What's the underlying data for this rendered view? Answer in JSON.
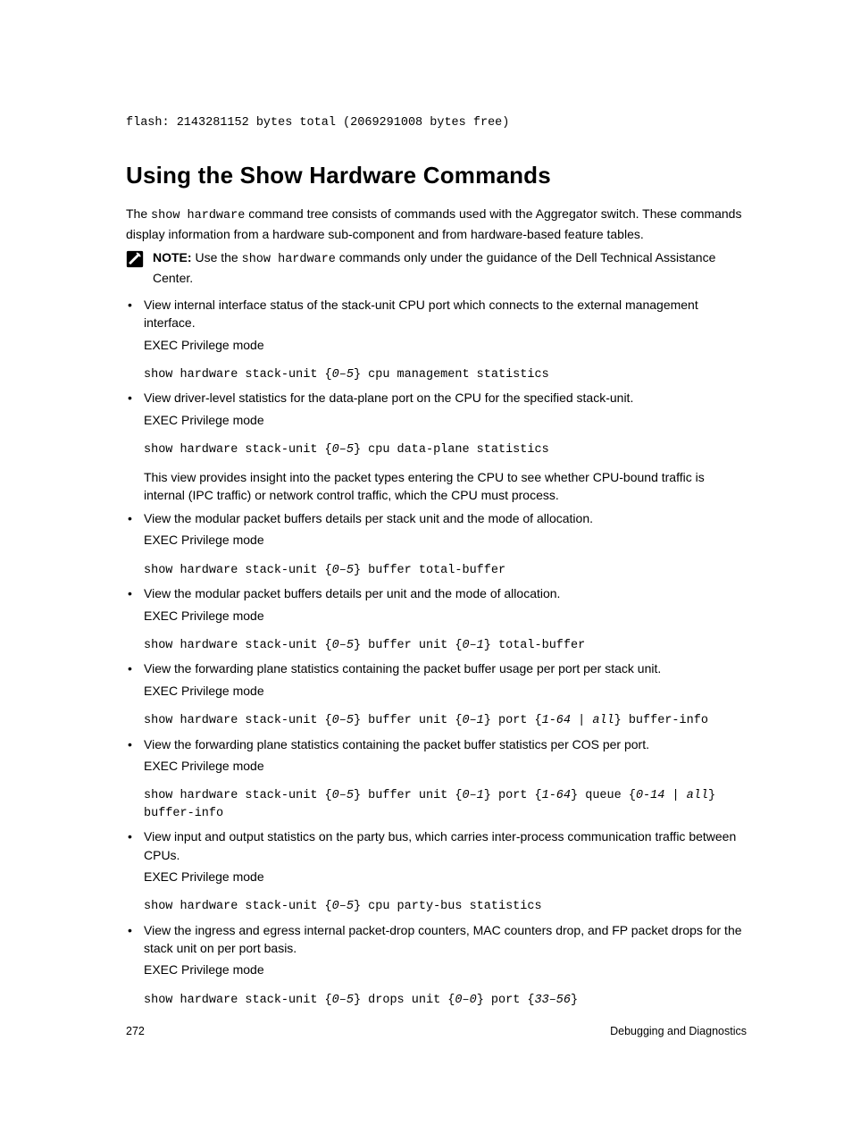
{
  "preformatted_top": "flash: 2143281152 bytes total (2069291008 bytes free)",
  "heading": "Using the Show Hardware Commands",
  "intro": {
    "pre": "The ",
    "code": "show hardware",
    "post": " command tree consists of commands used with the Aggregator switch. These commands display information from a hardware sub-component and from hardware-based feature tables."
  },
  "note": {
    "label": "NOTE:",
    "pre": " Use the ",
    "code": "show hardware",
    "post": " commands only under the guidance of the Dell Technical Assistance Center."
  },
  "items": [
    {
      "desc": "View internal interface status of the stack-unit CPU port which connects to the external management interface.",
      "mode": "EXEC Privilege mode",
      "cmd_parts": [
        {
          "t": "show hardware stack-unit {",
          "i": false
        },
        {
          "t": "0–5",
          "i": true
        },
        {
          "t": "} cpu management statistics",
          "i": false
        }
      ]
    },
    {
      "desc": "View driver-level statistics for the data-plane port on the CPU for the specified stack-unit.",
      "mode": "EXEC Privilege mode",
      "cmd_parts": [
        {
          "t": "show hardware stack-unit {",
          "i": false
        },
        {
          "t": "0–5",
          "i": true
        },
        {
          "t": "} cpu data-plane statistics",
          "i": false
        }
      ],
      "post": "This view provides insight into the packet types entering the CPU to see whether CPU-bound traffic is internal (IPC traffic) or network control traffic, which the CPU must process."
    },
    {
      "desc": "View the modular packet buffers details per stack unit and the mode of allocation.",
      "mode": "EXEC Privilege mode",
      "cmd_parts": [
        {
          "t": "show hardware stack-unit {",
          "i": false
        },
        {
          "t": "0–5",
          "i": true
        },
        {
          "t": "} buffer total-buffer",
          "i": false
        }
      ]
    },
    {
      "desc": "View the modular packet buffers details per unit and the mode of allocation.",
      "mode": "EXEC Privilege mode",
      "cmd_parts": [
        {
          "t": "show hardware stack-unit {",
          "i": false
        },
        {
          "t": "0–5",
          "i": true
        },
        {
          "t": "} buffer unit {",
          "i": false
        },
        {
          "t": "0–1",
          "i": true
        },
        {
          "t": "} total-buffer",
          "i": false
        }
      ]
    },
    {
      "desc": "View the forwarding plane statistics containing the packet buffer usage per port per stack unit.",
      "mode": "EXEC Privilege mode",
      "cmd_parts": [
        {
          "t": "show hardware stack-unit {",
          "i": false
        },
        {
          "t": "0–5",
          "i": true
        },
        {
          "t": "} buffer unit {",
          "i": false
        },
        {
          "t": "0–1",
          "i": true
        },
        {
          "t": "} port {",
          "i": false
        },
        {
          "t": "1-64 | all",
          "i": true
        },
        {
          "t": "} buffer-info",
          "i": false
        }
      ]
    },
    {
      "desc": "View the forwarding plane statistics containing the packet buffer statistics per COS per port.",
      "mode": "EXEC Privilege mode",
      "cmd_parts": [
        {
          "t": "show hardware stack-unit {",
          "i": false
        },
        {
          "t": "0–5",
          "i": true
        },
        {
          "t": "} buffer unit {",
          "i": false
        },
        {
          "t": "0–1",
          "i": true
        },
        {
          "t": "} port {",
          "i": false
        },
        {
          "t": "1-64",
          "i": true
        },
        {
          "t": "} queue {",
          "i": false
        },
        {
          "t": "0-14 | all",
          "i": true
        },
        {
          "t": "} buffer-info",
          "i": false
        }
      ]
    },
    {
      "desc": "View input and output statistics on the party bus, which carries inter-process communication traffic between CPUs.",
      "mode": "EXEC Privilege mode",
      "cmd_parts": [
        {
          "t": "show hardware stack-unit {",
          "i": false
        },
        {
          "t": "0–5",
          "i": true
        },
        {
          "t": "} cpu party-bus statistics",
          "i": false
        }
      ]
    },
    {
      "desc": "View the ingress and egress internal packet-drop counters, MAC counters drop, and FP packet drops for the stack unit on per port basis.",
      "mode": "EXEC Privilege mode",
      "cmd_parts": [
        {
          "t": "show hardware stack-unit {",
          "i": false
        },
        {
          "t": "0–5",
          "i": true
        },
        {
          "t": "} drops unit {",
          "i": false
        },
        {
          "t": "0–0",
          "i": true
        },
        {
          "t": "} port {",
          "i": false
        },
        {
          "t": "33–56",
          "i": true
        },
        {
          "t": "}",
          "i": false
        }
      ]
    }
  ],
  "footer": {
    "page": "272",
    "section": "Debugging and Diagnostics"
  }
}
